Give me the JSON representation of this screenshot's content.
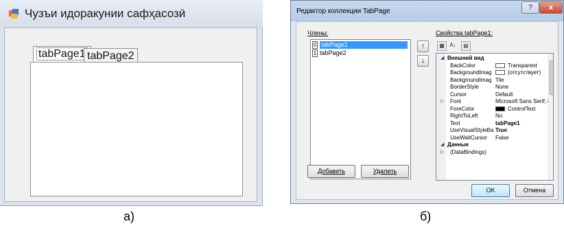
{
  "panelA": {
    "window_title": "Чузъи идоракунии сафҳасозӣ",
    "tabs": [
      "tabPage1",
      "tabPage2"
    ],
    "caption": "а)"
  },
  "panelB": {
    "window_title": "Редактор коллекции TabPage",
    "help_label": "?",
    "close_label": "x",
    "members_label": "Члены:",
    "members": [
      {
        "index": "0",
        "name": "tabPage1",
        "selected": true
      },
      {
        "index": "1",
        "name": "tabPage2",
        "selected": false
      }
    ],
    "move_up_label": "↑",
    "move_down_label": "↓",
    "properties_label": "Свойства tabPage1:",
    "properties": [
      {
        "type": "category",
        "expander": "◢",
        "name": "Внешний вид"
      },
      {
        "name": "BackColor",
        "value": "Transparent",
        "swatch": "#ffffff"
      },
      {
        "name": "BackgroundImag",
        "value": "(отсутствует)",
        "swatch": "#ffffff"
      },
      {
        "name": "BackgroundImag",
        "value": "Tile"
      },
      {
        "name": "BorderStyle",
        "value": "None"
      },
      {
        "name": "Cursor",
        "value": "Default"
      },
      {
        "expander": "▷",
        "name": "Font",
        "value": "Microsoft Sans Serif; 8"
      },
      {
        "name": "ForeColor",
        "value": "ControlText",
        "swatch": "#000000"
      },
      {
        "name": "RightToLeft",
        "value": "No"
      },
      {
        "name": "Text",
        "value": "tabPage1",
        "bold": true
      },
      {
        "name": "UseVisualStyleBa",
        "value": "True",
        "bold": true
      },
      {
        "name": "UseWaitCursor",
        "value": "False"
      },
      {
        "type": "category",
        "expander": "◢",
        "name": "Данные"
      },
      {
        "expander": "▷",
        "name": "(DataBindings)",
        "value": ""
      }
    ],
    "add_button": "Добавить",
    "remove_button": "Удалить",
    "ok_button": "OK",
    "cancel_button": "Отмена",
    "caption": "б)"
  }
}
